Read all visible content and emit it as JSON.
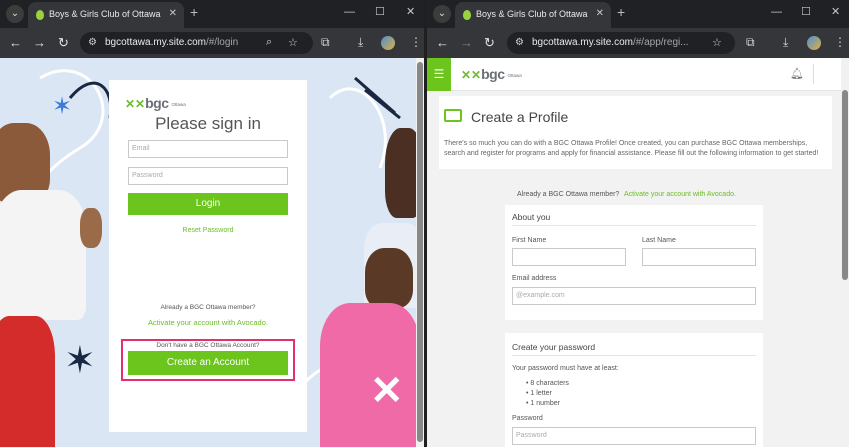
{
  "left_window": {
    "tab_title": "Boys & Girls Club of Ottawa",
    "url_host": "bgcottawa.my.site.com",
    "url_path": "/#/login",
    "login": {
      "logo_text": "bgc",
      "logo_sub": "Ottawa",
      "title": "Please sign in",
      "email_placeholder": "Email",
      "password_placeholder": "Password",
      "login_button": "Login",
      "reset_link": "Reset Password",
      "member_question": "Already a BGC Ottawa member?",
      "activate_link": "Activate your account with Avocado.",
      "no_account_question": "Don't have a BGC Ottawa Account?",
      "create_button": "Create an Account"
    }
  },
  "right_window": {
    "tab_title": "Boys & Girls Club of Ottawa",
    "url_host": "bgcottawa.my.site.com",
    "url_path": "/#/app/regi...",
    "header": {
      "logo_text": "bgc",
      "logo_sub": "Ottawa"
    },
    "profile": {
      "title": "Create a Profile",
      "description": "There's so much you can do with a BGC Ottawa Profile! Once created, you can purchase BGC Ottawa memberships, search and register for programs and apply for financial assistance. Please fill out the following information to get started!"
    },
    "member_question": "Already a BGC Ottawa member?",
    "activate_link": "Activate your account with Avocado.",
    "about": {
      "title": "About you",
      "first_name_label": "First Name",
      "last_name_label": "Last Name",
      "email_label": "Email address",
      "email_placeholder": "@example.com"
    },
    "password_section": {
      "title": "Create your password",
      "requirements_intro": "Your password must have at least:",
      "requirements": [
        "8 characters",
        "1 letter",
        "1 number"
      ],
      "password_label": "Password",
      "password_placeholder": "Password"
    }
  },
  "colors": {
    "brand_green": "#6bc51c",
    "highlight": "#e4316a",
    "chrome_dark": "#202124"
  }
}
